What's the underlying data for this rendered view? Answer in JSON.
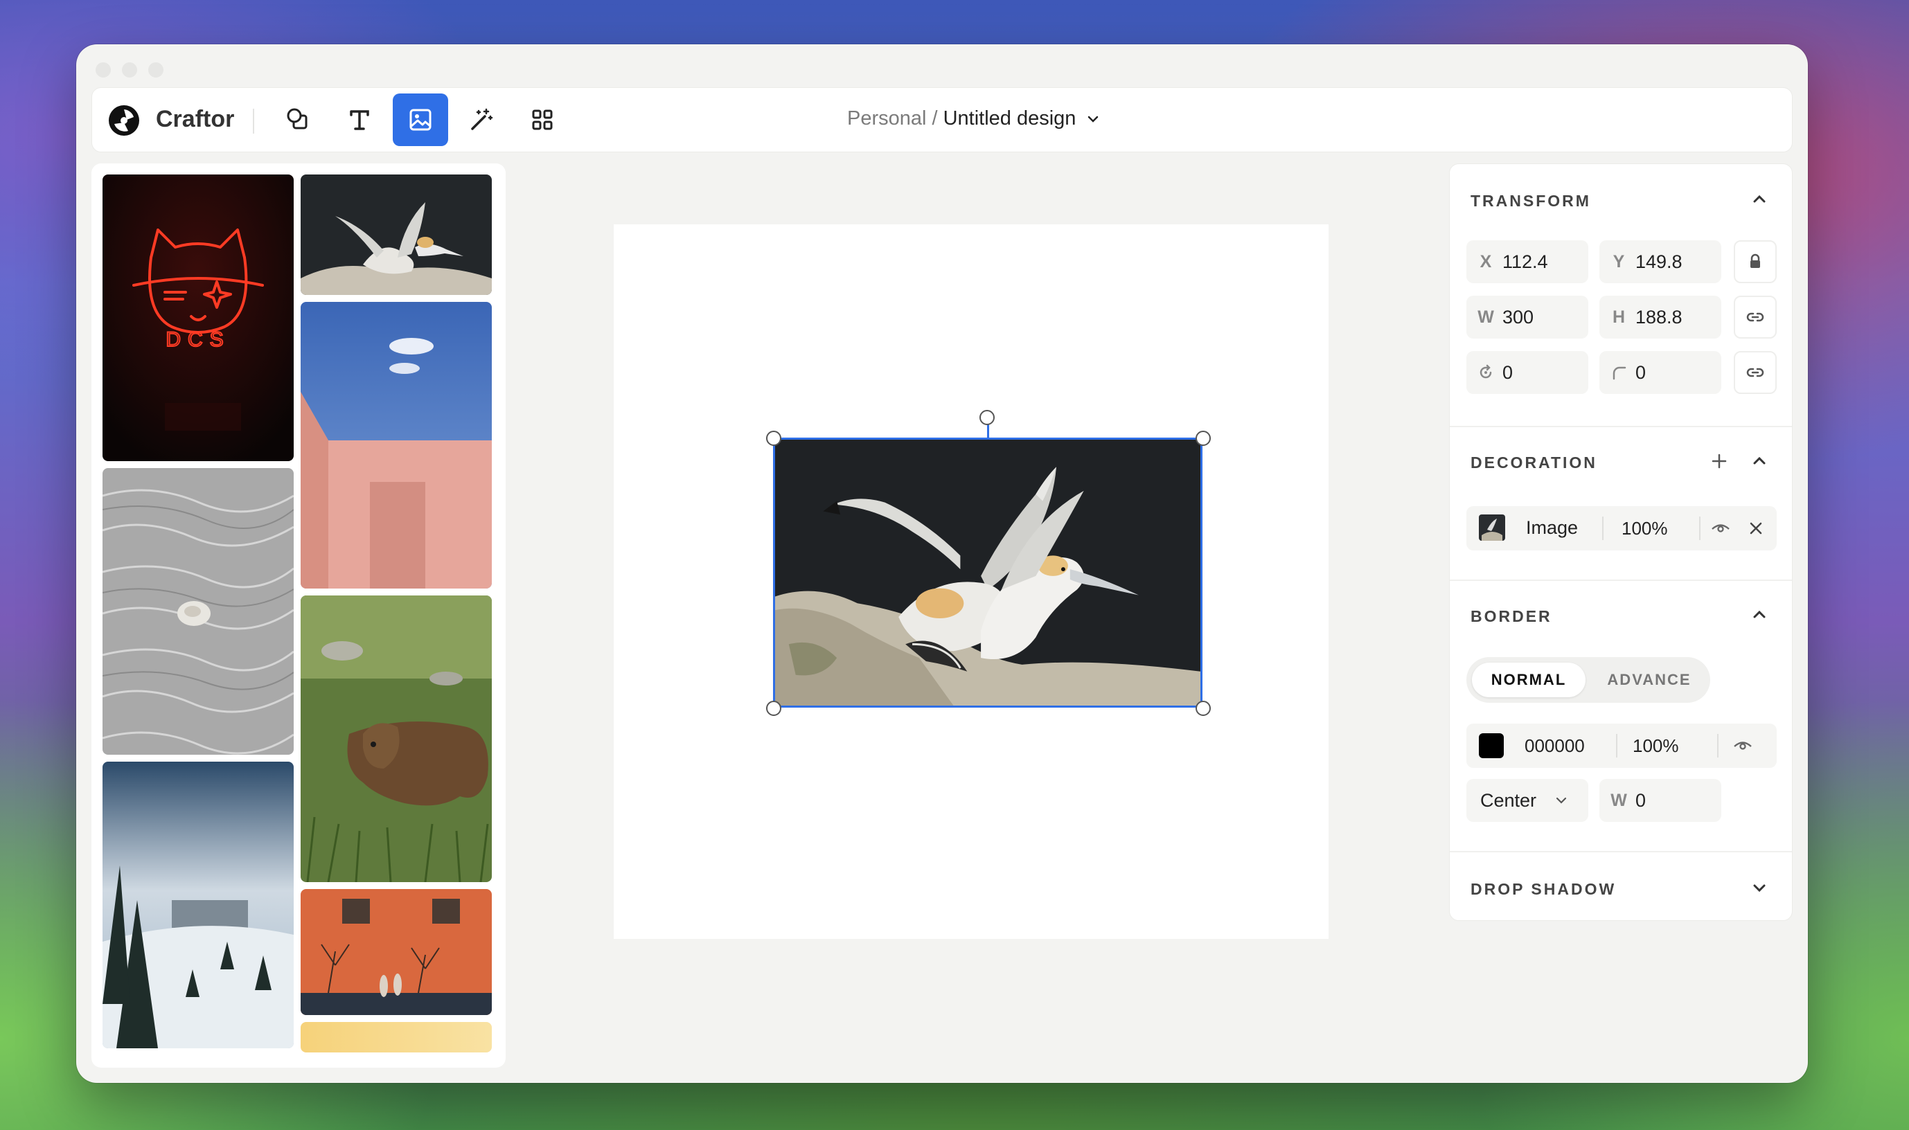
{
  "app": {
    "name": "Craftor"
  },
  "breadcrumb": {
    "workspace": "Personal /",
    "document": "Untitled design"
  },
  "toolbar": {
    "tools": [
      {
        "name": "shapes-tool",
        "icon": "shapes-icon",
        "active": false
      },
      {
        "name": "text-tool",
        "icon": "text-icon",
        "active": false
      },
      {
        "name": "image-tool",
        "icon": "image-icon",
        "active": true
      },
      {
        "name": "magic-tool",
        "icon": "magic-wand-icon",
        "active": false
      },
      {
        "name": "components-tool",
        "icon": "grid-icon",
        "active": false
      }
    ]
  },
  "gallery": {
    "neon_text": "DCS",
    "images": [
      {
        "name": "neon-cat-sign"
      },
      {
        "name": "gannets-small"
      },
      {
        "name": "pink-wall-sky"
      },
      {
        "name": "shell-water"
      },
      {
        "name": "bear-grass"
      },
      {
        "name": "snowy-forest"
      },
      {
        "name": "orange-wall-people"
      },
      {
        "name": "yellow-partial"
      }
    ]
  },
  "canvas": {
    "selected_image": "gannets"
  },
  "transform": {
    "title": "TRANSFORM",
    "x_label": "X",
    "x": "112.4",
    "y_label": "Y",
    "y": "149.8",
    "w_label": "W",
    "w": "300",
    "h_label": "H",
    "h": "188.8",
    "rotation": "0",
    "radius": "0"
  },
  "decoration": {
    "title": "DECORATION",
    "layer_name": "Image",
    "opacity": "100%"
  },
  "border": {
    "title": "BORDER",
    "mode_normal": "NORMAL",
    "mode_advance": "ADVANCE",
    "color_hex": "000000",
    "color": "#000000",
    "opacity": "100%",
    "position": "Center",
    "width_label": "W",
    "width": "0"
  },
  "drop_shadow": {
    "title": "DROP SHADOW"
  },
  "colors": {
    "accent": "#2f6fe6"
  }
}
